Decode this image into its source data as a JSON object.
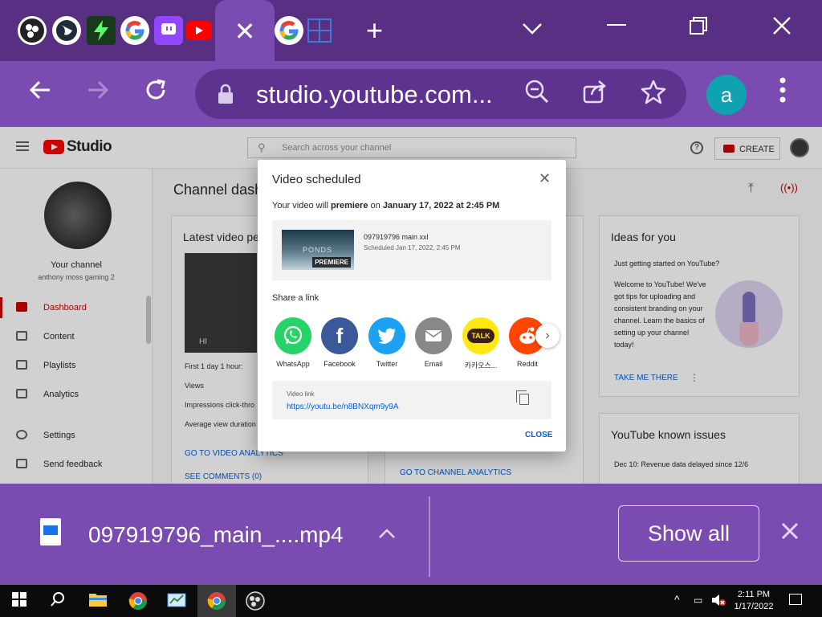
{
  "browser": {
    "active_tab_close": "✕",
    "url": "studio.youtube.com...",
    "profile_initial": "a",
    "icons": [
      "obs-icon",
      "globe-icon",
      "bolt-icon",
      "google-icon",
      "twitch-icon",
      "youtube-icon",
      "close-icon",
      "google-icon",
      "grid-icon",
      "new-tab-icon",
      "back-icon",
      "forward-icon",
      "reload-icon",
      "lock-icon",
      "zoom-out-icon",
      "share-icon",
      "star-icon",
      "kebab-icon"
    ],
    "colors": {
      "frame": "#582f82",
      "toolbar": "#7a4bb0",
      "omnibox": "#5e3390",
      "profile": "#0fa3b1"
    }
  },
  "studio": {
    "logo_text": "Studio",
    "search_placeholder": "Search across your channel",
    "create_label": "CREATE",
    "your_channel": "Your channel",
    "channel_name": "anthony moss gaming 2",
    "nav": [
      {
        "label": "Dashboard",
        "active": true
      },
      {
        "label": "Content"
      },
      {
        "label": "Playlists"
      },
      {
        "label": "Analytics"
      },
      {
        "label": "Settings"
      },
      {
        "label": "Send feedback"
      }
    ],
    "dashboard_title": "Channel dash",
    "latest": {
      "title": "Latest video pe",
      "thumb_text": "HI",
      "stats": [
        "First 1 day 1 hour:",
        "Views",
        "Impressions click-thro",
        "Average view duration"
      ],
      "analytics_link": "GO TO VIDEO ANALYTICS",
      "comments_link": "SEE COMMENTS (0)"
    },
    "channel_analytics_link": "GO TO CHANNEL ANALYTICS",
    "ideas": {
      "title": "Ideas for you",
      "subtitle": "Just getting started on YouTube?",
      "body": "Welcome to YouTube! We've got tips for uploading and consistent branding on your channel. Learn the basics of setting up your channel today!",
      "cta": "TAKE ME THERE"
    },
    "issues": {
      "title": "YouTube known issues",
      "line": "Dec 10: Revenue data delayed since 12/6"
    }
  },
  "modal": {
    "title": "Video scheduled",
    "msg_prefix": "Your video will ",
    "msg_bold1": "premiere",
    "msg_mid": " on ",
    "msg_bold2": "January 17, 2022 at 2:45 PM",
    "video_title": "097919796 main xxl",
    "video_schedule": "Scheduled Jan 17, 2022, 2:45 PM",
    "thumb_watermark": "PONDS",
    "thumb_badge": "PREMIERE",
    "share_label": "Share a link",
    "share_targets": [
      {
        "name": "WhatsApp",
        "color": "#25d366"
      },
      {
        "name": "Facebook",
        "color": "#3b5998"
      },
      {
        "name": "Twitter",
        "color": "#1da1f2"
      },
      {
        "name": "Email",
        "color": "#888888"
      },
      {
        "name": "카카오스...",
        "color": "#ffe812"
      },
      {
        "name": "Reddit",
        "color": "#ff4500"
      }
    ],
    "kakao_badge": "TALK",
    "link_label": "Video link",
    "link_url": "https://youtu.be/n8BNXqm9y9A",
    "close_label": "CLOSE"
  },
  "download": {
    "file_name": "097919796_main_....mp4",
    "show_all": "Show all"
  },
  "taskbar": {
    "time": "2:11 PM",
    "date": "1/17/2022"
  }
}
